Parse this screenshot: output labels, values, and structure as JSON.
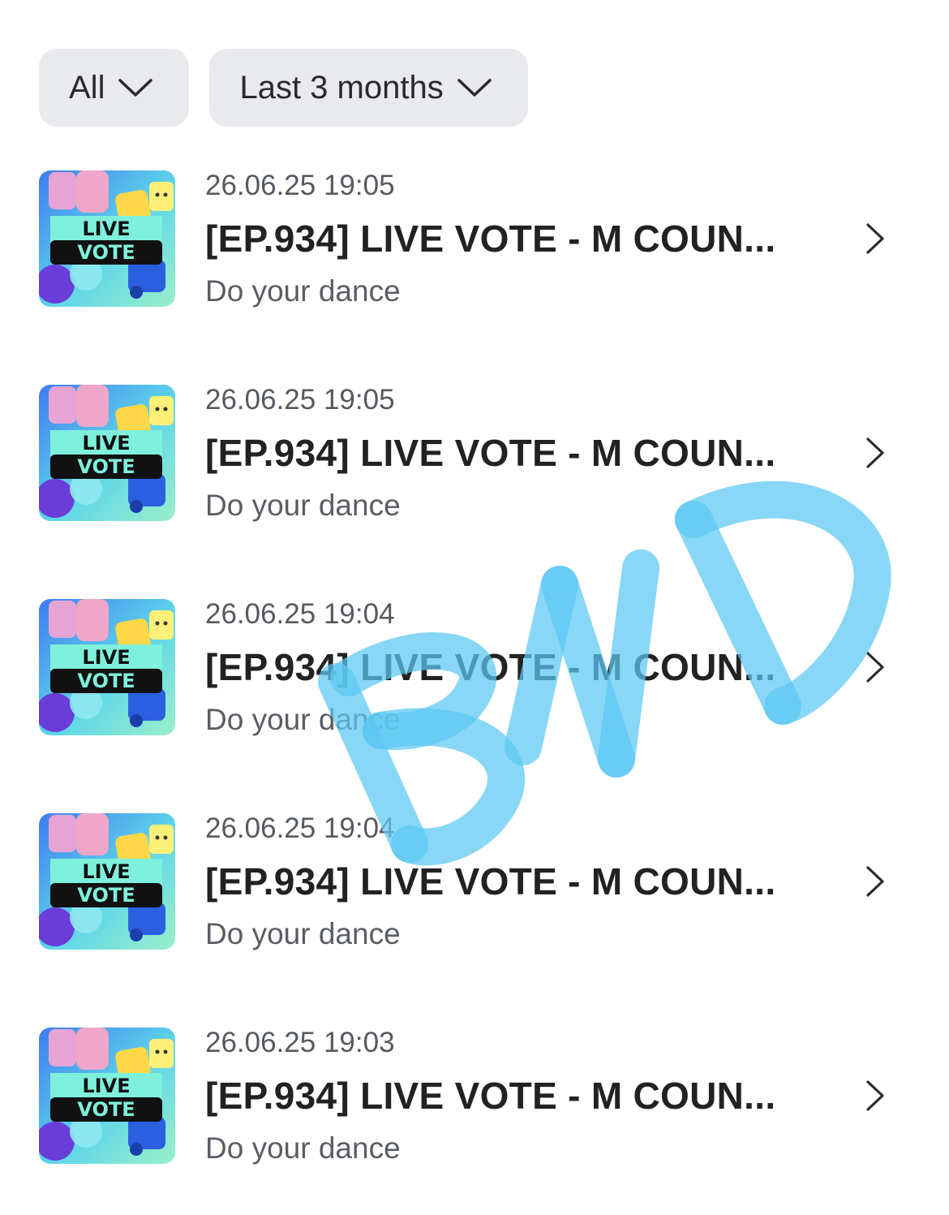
{
  "filters": {
    "category": {
      "label": "All"
    },
    "period": {
      "label": "Last 3 months"
    }
  },
  "thumbnail": {
    "line1": "LIVE",
    "line2": "VOTE"
  },
  "items": [
    {
      "date": "26.06.25 19:05",
      "title": "[EP.934] LIVE VOTE - M COUN...",
      "subtitle": "Do your dance"
    },
    {
      "date": "26.06.25 19:05",
      "title": "[EP.934] LIVE VOTE - M COUN...",
      "subtitle": "Do your dance"
    },
    {
      "date": "26.06.25 19:04",
      "title": "[EP.934] LIVE VOTE - M COUN...",
      "subtitle": "Do your dance"
    },
    {
      "date": "26.06.25 19:04",
      "title": "[EP.934] LIVE VOTE - M COUN...",
      "subtitle": "Do your dance"
    },
    {
      "date": "26.06.25 19:03",
      "title": "[EP.934] LIVE VOTE - M COUN...",
      "subtitle": "Do your dance"
    }
  ],
  "watermark": {
    "text": "BND",
    "color": "#5cc8f2"
  },
  "colors": {
    "chip_bg": "#e9eaed",
    "text_primary": "#222222",
    "text_secondary": "#555a60"
  }
}
